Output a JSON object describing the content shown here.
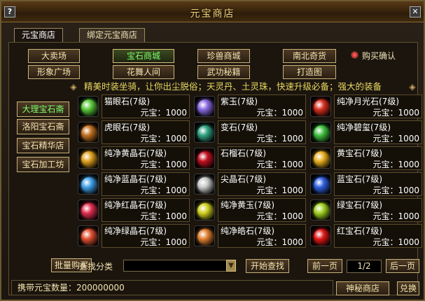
{
  "window": {
    "title": "元宝商店",
    "help_btn": "?",
    "close_btn": "✕"
  },
  "tabs": [
    {
      "label": "元宝商店"
    },
    {
      "label": "绑定元宝商店"
    }
  ],
  "categories": [
    {
      "label": "大卖场"
    },
    {
      "label": "宝石商城"
    },
    {
      "label": "珍兽商城"
    },
    {
      "label": "南北奇货"
    },
    {
      "label": "形象广场"
    },
    {
      "label": "花舞人间"
    },
    {
      "label": "武功秘籍"
    },
    {
      "label": "打造图"
    }
  ],
  "confirm_label": "购买确认",
  "marquee": "精美时装坐骑，让你出尘脱俗；天灵丹、土灵珠，快速升级必备；强大的装备",
  "side_nav": [
    {
      "label": "大理宝石斋"
    },
    {
      "label": "洛阳宝石斋"
    },
    {
      "label": "宝石精华店"
    },
    {
      "label": "宝石加工坊"
    }
  ],
  "items": [
    {
      "name": "猫眼石(7级)",
      "price": "元宝：1000",
      "color": "#5ac83a"
    },
    {
      "name": "紫玉(7级)",
      "price": "元宝：1000",
      "color": "#8a6ae0"
    },
    {
      "name": "纯净月光石(7级)",
      "price": "元宝：1000",
      "color": "#d83020"
    },
    {
      "name": "虎眼石(7级)",
      "price": "元宝：1000",
      "color": "#c07020"
    },
    {
      "name": "变石(7级)",
      "price": "元宝：1000",
      "color": "#30a080"
    },
    {
      "name": "纯净碧玺(7级)",
      "price": "元宝：1000",
      "color": "#40c040"
    },
    {
      "name": "纯净黄晶石(7级)",
      "price": "元宝：1000",
      "color": "#e0a020"
    },
    {
      "name": "石榴石(7级)",
      "price": "元宝：1000",
      "color": "#c01020"
    },
    {
      "name": "黄宝石(7级)",
      "price": "元宝：1000",
      "color": "#e8b020"
    },
    {
      "name": "纯净蓝晶石(7级)",
      "price": "元宝：1000",
      "color": "#40a0e8"
    },
    {
      "name": "尖晶石(7级)",
      "price": "元宝：1000",
      "color": "#c8c8c8"
    },
    {
      "name": "蓝宝石(7级)",
      "price": "元宝：1000",
      "color": "#3060e0"
    },
    {
      "name": "纯净红晶石(7级)",
      "price": "元宝：1000",
      "color": "#e03050"
    },
    {
      "name": "纯净黄玉(7级)",
      "price": "元宝：1000",
      "color": "#d0d020"
    },
    {
      "name": "绿宝石(7级)",
      "price": "元宝：1000",
      "color": "#a0d020"
    },
    {
      "name": "纯净绿晶石(7级)",
      "price": "元宝：1000",
      "color": "#e05030"
    },
    {
      "name": "纯净皓石(7级)",
      "price": "元宝：1000",
      "color": "#e08030"
    },
    {
      "name": "红宝石(7级)",
      "price": "元宝：1000",
      "color": "#e01818"
    }
  ],
  "bottom": {
    "bulk_buy": "批量购买",
    "search_label": "查找分类",
    "start_search": "开始查找",
    "prev_page": "前一页",
    "page_indicator": "1/2",
    "next_page": "后一页"
  },
  "footer": {
    "carry_label": "携带元宝数量：",
    "carry_value": "200000000",
    "mystery_shop": "神秘商店",
    "exchange": "兑换"
  }
}
